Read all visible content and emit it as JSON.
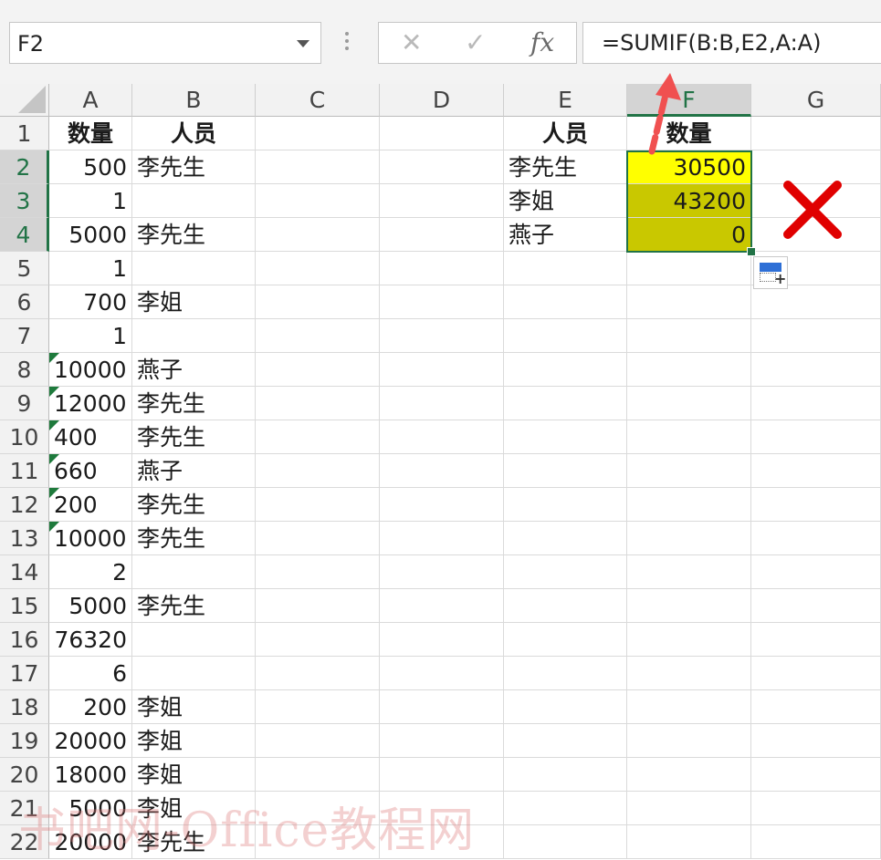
{
  "formula_bar": {
    "name_box": "F2",
    "cancel_icon": "✕",
    "enter_icon": "✓",
    "fx_label": "fx",
    "formula": "=SUMIF(B:B,E2,A:A)"
  },
  "columns": [
    "A",
    "B",
    "C",
    "D",
    "E",
    "F",
    "G"
  ],
  "selected_column": "F",
  "rows": [
    {
      "n": "1",
      "a": "数量",
      "b": "人员",
      "e": "人员",
      "f": "数量"
    },
    {
      "n": "2",
      "a": "500",
      "b": "李先生",
      "e": "李先生",
      "f": "30500"
    },
    {
      "n": "3",
      "a": "1",
      "b": "",
      "e": "李姐",
      "f": "43200"
    },
    {
      "n": "4",
      "a": "5000",
      "b": "李先生",
      "e": "燕子",
      "f": "0"
    },
    {
      "n": "5",
      "a": "1",
      "b": ""
    },
    {
      "n": "6",
      "a": "700",
      "b": "李姐"
    },
    {
      "n": "7",
      "a": "1",
      "b": ""
    },
    {
      "n": "8",
      "a": "10000",
      "b": "燕子"
    },
    {
      "n": "9",
      "a": "12000",
      "b": "李先生"
    },
    {
      "n": "10",
      "a": "400",
      "b": "李先生"
    },
    {
      "n": "11",
      "a": "660",
      "b": "燕子"
    },
    {
      "n": "12",
      "a": "200",
      "b": "李先生"
    },
    {
      "n": "13",
      "a": "10000",
      "b": "李先生"
    },
    {
      "n": "14",
      "a": "2",
      "b": ""
    },
    {
      "n": "15",
      "a": "5000",
      "b": "李先生"
    },
    {
      "n": "16",
      "a": "76320",
      "b": ""
    },
    {
      "n": "17",
      "a": "6",
      "b": ""
    },
    {
      "n": "18",
      "a": "200",
      "b": "李姐"
    },
    {
      "n": "19",
      "a": "20000",
      "b": "李姐"
    },
    {
      "n": "20",
      "a": "18000",
      "b": "李姐"
    },
    {
      "n": "21",
      "a": "5000",
      "b": "李姐"
    },
    {
      "n": "22",
      "a": "20000",
      "b": "李先生"
    }
  ],
  "colors": {
    "highlight_f2": "#ffff00",
    "highlight_f3_f4": "#c9c800",
    "selection_green": "#217346",
    "error_mark": "#e00000",
    "arrow": "#f05050"
  },
  "watermark": "书吧网-Office教程网"
}
